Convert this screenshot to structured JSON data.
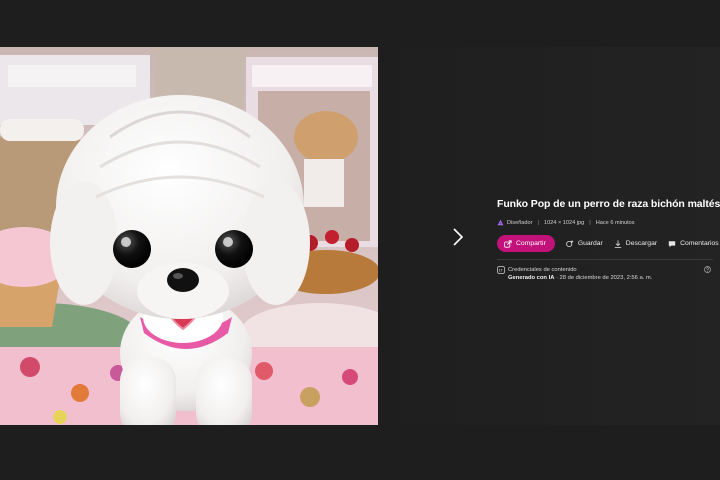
{
  "details": {
    "title": "Funko Pop de un perro de raza bichón maltés",
    "creator": "Diseñador",
    "dimensions": "1024 × 1024 jpg",
    "time_ago": "Hace 6 minutos"
  },
  "actions": {
    "share": "Compartir",
    "save": "Guardar",
    "download": "Descargar",
    "comments": "Comentarios"
  },
  "credentials": {
    "label": "Credenciales de contenido",
    "generated": "Generado con IA",
    "date": " · 28 de diciembre de 2023, 2:56 a. m."
  },
  "image": {
    "description_icon": "funko-dog-image"
  },
  "colors": {
    "accent": "#c2127a",
    "background": "#1e1e1e"
  },
  "icons": [
    "chevron-right-icon",
    "designer-icon",
    "share-icon",
    "save-icon",
    "download-icon",
    "comment-icon",
    "credentials-icon",
    "help-icon"
  ]
}
